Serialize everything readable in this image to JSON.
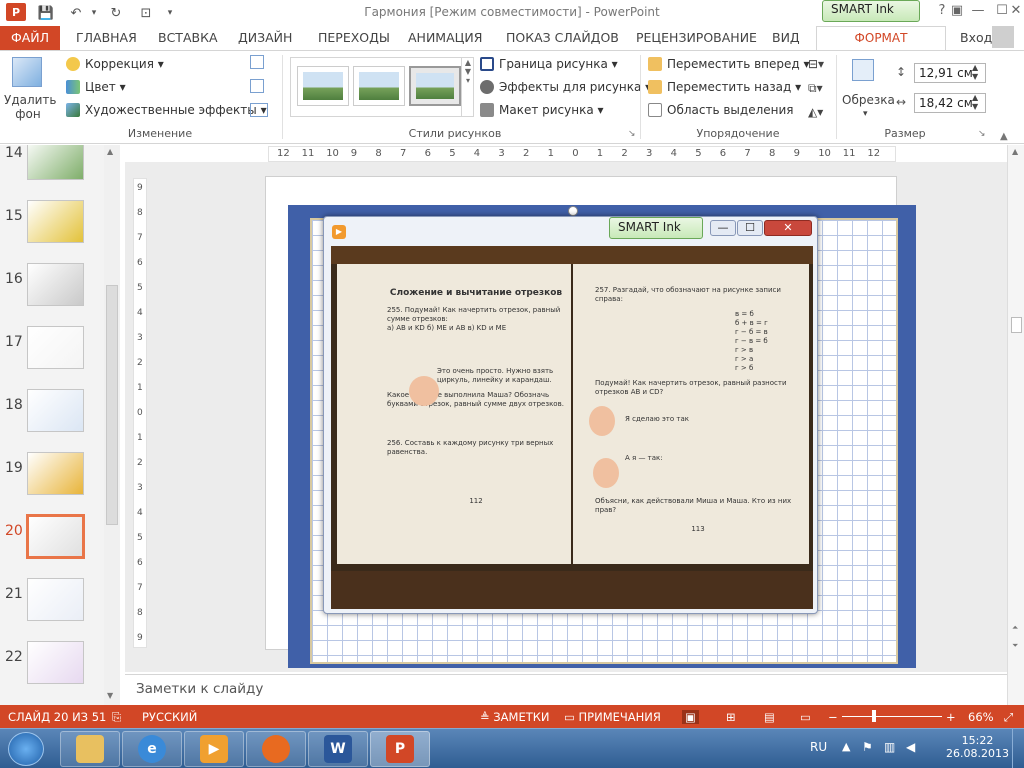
{
  "titlebar": {
    "title": "Гармония [Режим совместимости] - PowerPoint",
    "logo": "P",
    "qat_icons": [
      "save-icon",
      "undo-icon",
      "redo-icon",
      "present-icon",
      "customize-icon"
    ],
    "smart_ink": "SMART Ink",
    "help": "?",
    "min": "—",
    "max": "☐",
    "close": "✕"
  },
  "tabs": {
    "file": "ФАЙЛ",
    "items": [
      "ГЛАВНАЯ",
      "ВСТАВКА",
      "ДИЗАЙН",
      "ПЕРЕХОДЫ",
      "АНИМАЦИЯ",
      "ПОКАЗ СЛАЙДОВ",
      "РЕЦЕНЗИРОВАНИЕ",
      "ВИД"
    ],
    "format": "ФОРМАТ",
    "signin": "Вход"
  },
  "ribbon": {
    "remove_bg_1": "Удалить",
    "remove_bg_2": "фон",
    "correction": "Коррекция ▾",
    "color": "Цвет ▾",
    "art_effects": "Художественные эффекты ▾",
    "group_change": "Изменение",
    "border": "Граница рисунка ▾",
    "effects": "Эффекты для рисунка ▾",
    "layout": "Макет рисунка ▾",
    "group_styles": "Стили рисунков",
    "bring_forward": "Переместить вперед ▾",
    "send_backward": "Переместить назад ▾",
    "selection_pane": "Область выделения",
    "group_arrange": "Упорядочение",
    "crop": "Обрезка",
    "height": "12,91 см",
    "width": "18,42 см",
    "group_size": "Размер"
  },
  "ruler": {
    "h": [
      "12",
      "11",
      "10",
      "9",
      "8",
      "7",
      "6",
      "5",
      "4",
      "3",
      "2",
      "1",
      "0",
      "1",
      "2",
      "3",
      "4",
      "5",
      "6",
      "7",
      "8",
      "9",
      "10",
      "11",
      "12"
    ],
    "v": [
      "9",
      "8",
      "7",
      "6",
      "5",
      "4",
      "3",
      "2",
      "1",
      "0",
      "1",
      "2",
      "3",
      "4",
      "5",
      "6",
      "7",
      "8",
      "9"
    ]
  },
  "thumbnails": [
    {
      "num": "14"
    },
    {
      "num": "15"
    },
    {
      "num": "16"
    },
    {
      "num": "17"
    },
    {
      "num": "18"
    },
    {
      "num": "19"
    },
    {
      "num": "20"
    },
    {
      "num": "21"
    },
    {
      "num": "22"
    }
  ],
  "selected_thumb": "20",
  "photo_window": {
    "smart_ink": "SMART Ink",
    "min": "—",
    "max": "☐",
    "close": "✕",
    "left_page": {
      "title": "Сложение и вычитание отрезков",
      "t255": "255. Подумай! Как начертить отрезок, равный сумме отрезков:",
      "t255b": "а) AB и KD    б) ME и AB    в) KD и ME",
      "speech": "Это очень просто. Нужно взять циркуль, линейку и карандаш.",
      "q": "Какое задание выполнила Маша? Обозначь буквами отрезок, равный сумме двух отрезков.",
      "t256": "256. Составь к каждому рисунку три верных равенства.",
      "page_num": "112"
    },
    "right_page": {
      "t257": "257. Разгадай, что обозначают на рисунке записи справа:",
      "formulas": "в = б\nб + в = г\nг − б = в\nг − в = б\nг > в\nг > а\nг > б",
      "q": "Подумай! Как начертить отрезок, равный разности отрезков AB и CD?",
      "speech1": "Я сделаю это так",
      "speech2": "А я — так:",
      "outro": "Объясни, как действовали Миша и Маша. Кто из них прав?",
      "page_num": "113"
    }
  },
  "notes": "Заметки к слайду",
  "status": {
    "slide": "СЛАЙД 20 ИЗ 51",
    "lang": "РУССКИЙ",
    "notes": "ЗАМЕТКИ",
    "comments": "ПРИМЕЧАНИЯ",
    "zoom": "66%"
  },
  "taskbar": {
    "lang": "RU",
    "time": "15:22",
    "date": "26.08.2013"
  },
  "colors": {
    "accent": "#d24726",
    "taskbar": "#3a6aa0",
    "slide_bg": "#4060a8"
  }
}
